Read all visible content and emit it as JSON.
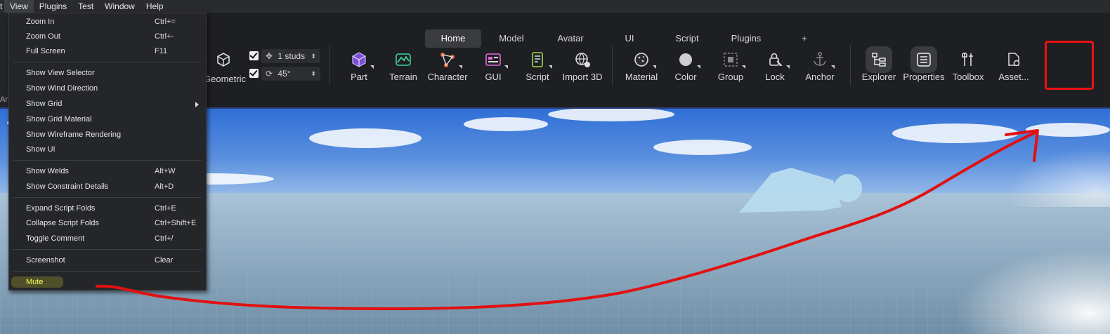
{
  "menubar": {
    "items": [
      "t",
      "View",
      "Plugins",
      "Test",
      "Window",
      "Help"
    ]
  },
  "tabs": [
    "Home",
    "Model",
    "Avatar",
    "UI",
    "Script",
    "Plugins",
    "+"
  ],
  "left_cut_text": "Ar",
  "transform": {
    "geometric_label": "Geometric",
    "move_snap": "1 studs",
    "rotate_snap": "45°"
  },
  "tools": {
    "part": "Part",
    "terrain": "Terrain",
    "character": "Character",
    "gui": "GUI",
    "script": "Script",
    "import3d": "Import 3D",
    "material": "Material",
    "color": "Color",
    "group": "Group",
    "lock": "Lock",
    "anchor": "Anchor",
    "explorer": "Explorer",
    "properties": "Properties",
    "toolbox": "Toolbox",
    "assets": "Asset..."
  },
  "view_menu": {
    "items": [
      {
        "label": "Zoom In",
        "shortcut": "Ctrl+="
      },
      {
        "label": "Zoom Out",
        "shortcut": "Ctrl+-"
      },
      {
        "label": "Full Screen",
        "shortcut": "F11"
      },
      {
        "label": "Show View Selector",
        "shortcut": ""
      },
      {
        "label": "Show Wind Direction",
        "shortcut": ""
      },
      {
        "label": "Show Grid",
        "shortcut": ""
      },
      {
        "label": "Show Grid Material",
        "shortcut": ""
      },
      {
        "label": "Show Wireframe Rendering",
        "shortcut": ""
      },
      {
        "label": "Show UI",
        "shortcut": ""
      },
      {
        "label": "Show Welds",
        "shortcut": "Alt+W"
      },
      {
        "label": "Show Constraint Details",
        "shortcut": "Alt+D"
      },
      {
        "label": "Expand Script Folds",
        "shortcut": "Ctrl+E"
      },
      {
        "label": "Collapse Script Folds",
        "shortcut": "Ctrl+Shift+E"
      },
      {
        "label": "Toggle Comment",
        "shortcut": "Ctrl+/"
      },
      {
        "label": "Screenshot",
        "shortcut": "Clear"
      },
      {
        "label": "Mute",
        "shortcut": ""
      }
    ]
  },
  "colors": {
    "annotation": "#e11111",
    "highlight": "#ffff6b",
    "sky_top": "#2f6fd6",
    "ground": "#7d9bb0"
  }
}
